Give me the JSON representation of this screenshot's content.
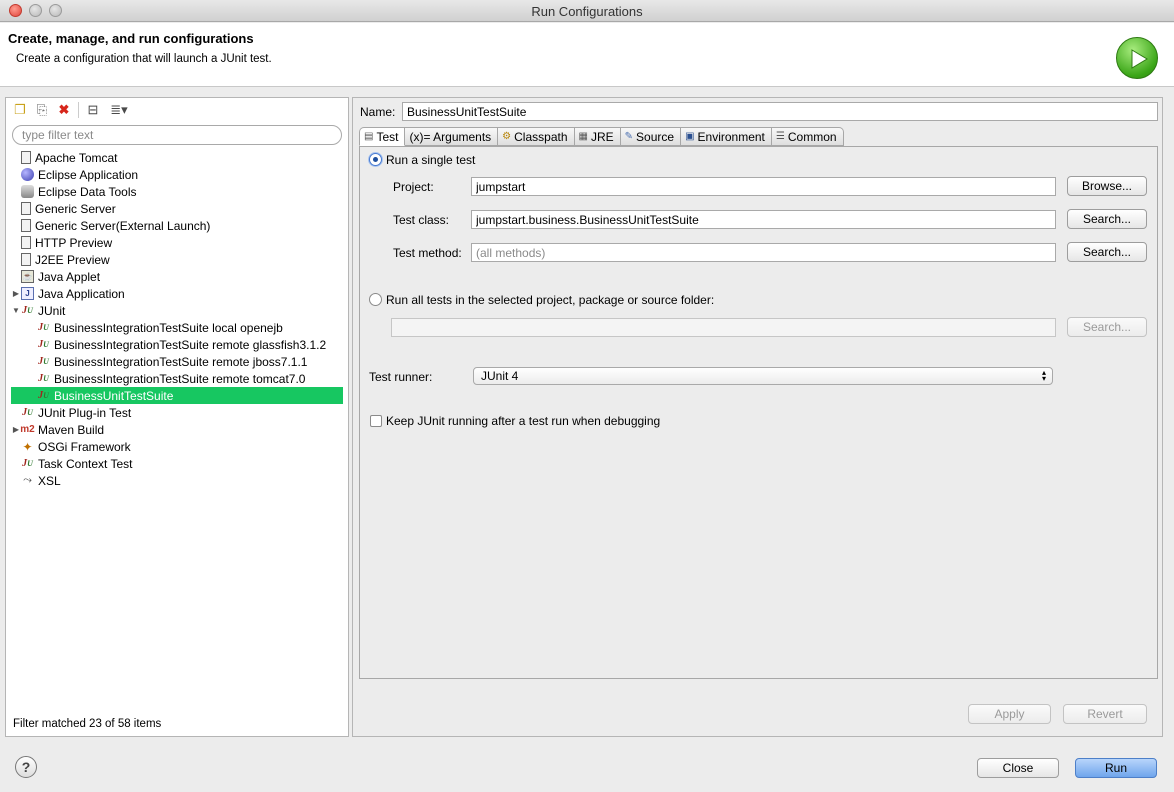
{
  "window": {
    "title": "Run Configurations"
  },
  "header": {
    "title": "Create, manage, and run configurations",
    "subtitle": "Create a configuration that will launch a JUnit test."
  },
  "sidebar": {
    "filter_placeholder": "type filter text",
    "items": [
      {
        "label": "Apache Tomcat",
        "icon": "server-icon",
        "level": 0
      },
      {
        "label": "Eclipse Application",
        "icon": "eclipse-icon",
        "level": 0
      },
      {
        "label": "Eclipse Data Tools",
        "icon": "database-icon",
        "level": 0
      },
      {
        "label": "Generic Server",
        "icon": "server-icon",
        "level": 0
      },
      {
        "label": "Generic Server(External Launch)",
        "icon": "server-icon",
        "level": 0
      },
      {
        "label": "HTTP Preview",
        "icon": "server-icon",
        "level": 0
      },
      {
        "label": "J2EE Preview",
        "icon": "server-icon",
        "level": 0
      },
      {
        "label": "Java Applet",
        "icon": "applet-icon",
        "level": 0
      },
      {
        "label": "Java Application",
        "icon": "java-app-icon",
        "level": 0,
        "expandable": true
      },
      {
        "label": "JUnit",
        "icon": "junit-icon",
        "level": 0,
        "expanded": true
      },
      {
        "label": "BusinessIntegrationTestSuite local openejb",
        "icon": "junit-icon",
        "level": 1
      },
      {
        "label": "BusinessIntegrationTestSuite remote glassfish3.1.2",
        "icon": "junit-icon",
        "level": 1
      },
      {
        "label": "BusinessIntegrationTestSuite remote jboss7.1.1",
        "icon": "junit-icon",
        "level": 1
      },
      {
        "label": "BusinessIntegrationTestSuite remote tomcat7.0",
        "icon": "junit-icon",
        "level": 1
      },
      {
        "label": "BusinessUnitTestSuite",
        "icon": "junit-icon",
        "level": 1,
        "selected": true
      },
      {
        "label": "JUnit Plug-in Test",
        "icon": "junit-plugin-icon",
        "level": 0
      },
      {
        "label": "Maven Build",
        "icon": "maven-icon",
        "level": 0,
        "expandable": true
      },
      {
        "label": "OSGi Framework",
        "icon": "osgi-icon",
        "level": 0
      },
      {
        "label": "Task Context Test",
        "icon": "junit-icon",
        "level": 0
      },
      {
        "label": "XSL",
        "icon": "xsl-icon",
        "level": 0
      }
    ],
    "status": "Filter matched 23 of 58 items",
    "selected_color": "#17c761"
  },
  "config": {
    "name_label": "Name:",
    "name_value": "BusinessUnitTestSuite",
    "tabs": [
      {
        "label": "Test",
        "icon": "test-tab-icon",
        "active": true
      },
      {
        "label": "(x)= Arguments",
        "icon": "arguments-icon"
      },
      {
        "label": "Classpath",
        "icon": "classpath-icon"
      },
      {
        "label": "JRE",
        "icon": "jre-icon"
      },
      {
        "label": "Source",
        "icon": "source-icon"
      },
      {
        "label": "Environment",
        "icon": "environment-icon"
      },
      {
        "label": "Common",
        "icon": "common-icon"
      }
    ],
    "test_tab": {
      "single_test_label": "Run a single test",
      "project_label": "Project:",
      "project_value": "jumpstart",
      "browse_label": "Browse...",
      "test_class_label": "Test class:",
      "test_class_value": "jumpstart.business.BusinessUnitTestSuite",
      "search_label": "Search...",
      "test_method_label": "Test method:",
      "test_method_placeholder": "(all methods)",
      "all_tests_label": "Run all tests in the selected project, package or source folder:",
      "container_value": "",
      "runner_label": "Test runner:",
      "runner_value": "JUnit 4",
      "keep_running_label": "Keep JUnit running after a test run when debugging"
    },
    "apply_label": "Apply",
    "revert_label": "Revert"
  },
  "footer": {
    "help_label": "?",
    "close_label": "Close",
    "run_label": "Run"
  }
}
